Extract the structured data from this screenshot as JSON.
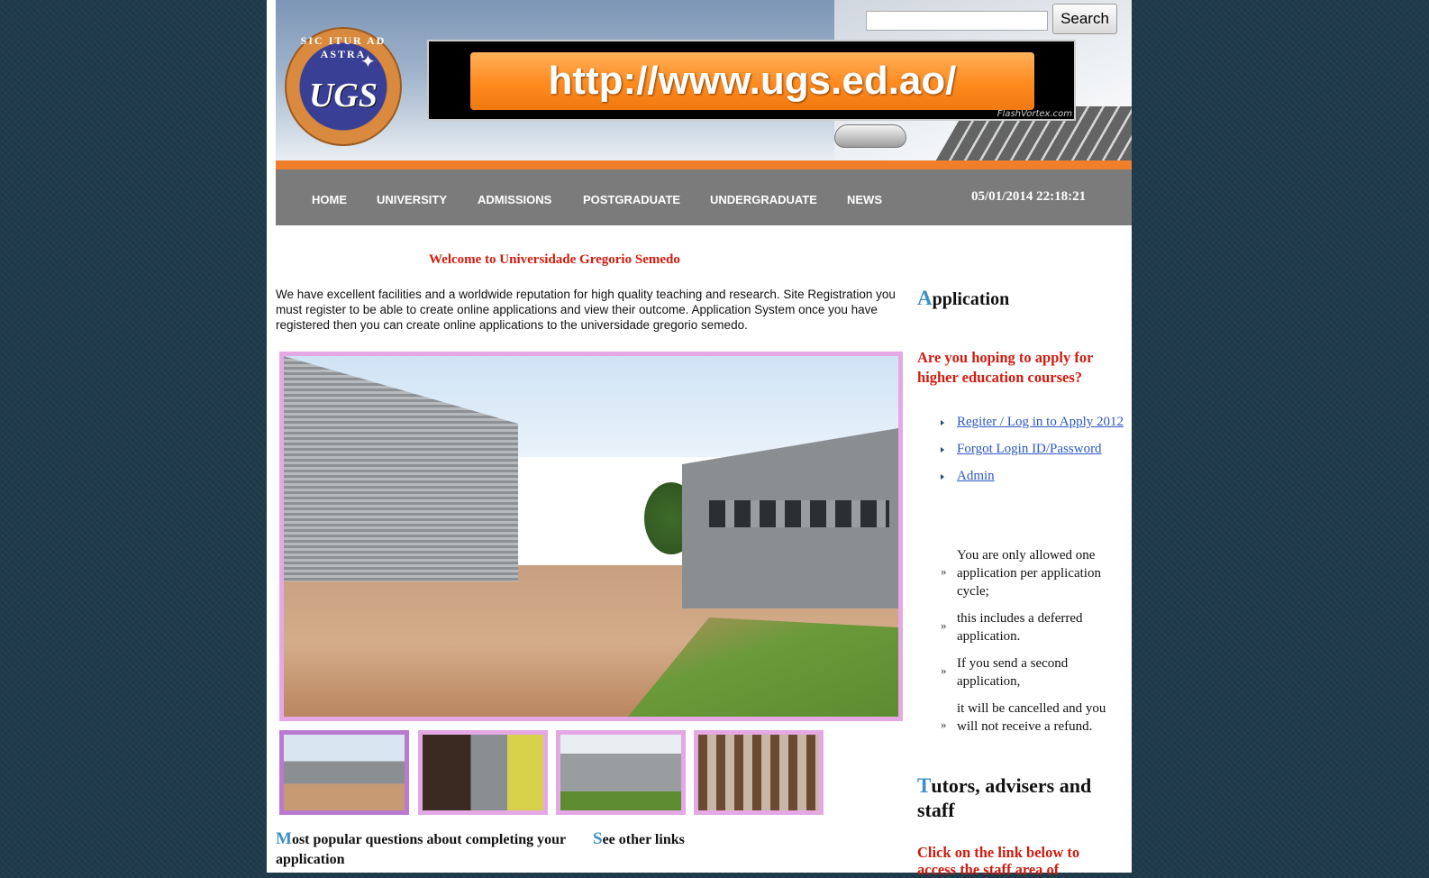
{
  "header": {
    "logo": {
      "ring_text": "SIC ITUR AD ASTRA",
      "monogram": "UGS"
    },
    "banner": {
      "url_text": "http://www.ugs.ed.ao/",
      "credit": "FlashVortex.com"
    },
    "search": {
      "placeholder": "",
      "value": "",
      "button_label": "Search"
    }
  },
  "nav": {
    "items": [
      {
        "label": "HOME"
      },
      {
        "label": "UNIVERSITY"
      },
      {
        "label": "ADMISSIONS"
      },
      {
        "label": "POSTGRADUATE"
      },
      {
        "label": "UNDERGRADUATE"
      },
      {
        "label": "NEWS"
      }
    ],
    "datetime": "05/01/2014 22:18:21"
  },
  "main": {
    "welcome": "Welcome to Universidade Gregorio Semedo",
    "intro": "We have excellent facilities and a worldwide reputation for high quality teaching and research. Site Registration you must register to be able to create online applications and view their outcome. Application System once you have registered then you can create online applications to the universidade gregorio semedo.",
    "gallery": {
      "thumbnail_count": 4,
      "active_index": 0
    },
    "faq_heading": {
      "cap": "M",
      "rest": "ost popular questions about completing your application"
    },
    "links_heading": {
      "cap": "S",
      "rest": "ee other links"
    }
  },
  "sidebar": {
    "application_heading": {
      "cap": "A",
      "rest": "pplication"
    },
    "question": "Are you hoping to apply for higher education courses?",
    "links": [
      {
        "label": "Regiter / Log in to Apply 2012"
      },
      {
        "label": "Forgot Login ID/Password"
      },
      {
        "label": "Admin"
      }
    ],
    "rules": [
      {
        "text": "You are only allowed one application per application cycle;"
      },
      {
        "text": "this includes a deferred application."
      },
      {
        "text": "If you send a second application,"
      },
      {
        "text": "it will be cancelled and you will not receive a refund."
      }
    ],
    "tutors_heading": {
      "cap": "T",
      "rest": "utors, advisers and staff"
    },
    "staff_cta": "Click on the link below to access the staff area of"
  },
  "colors": {
    "accent_orange": "#ef7f2b",
    "nav_gray": "#7b7b7b",
    "heading_red": "#d21b0e",
    "cap_blue": "#3d8fc4",
    "link_blue": "#2b56c4",
    "photo_border": "#e4a9e4"
  }
}
